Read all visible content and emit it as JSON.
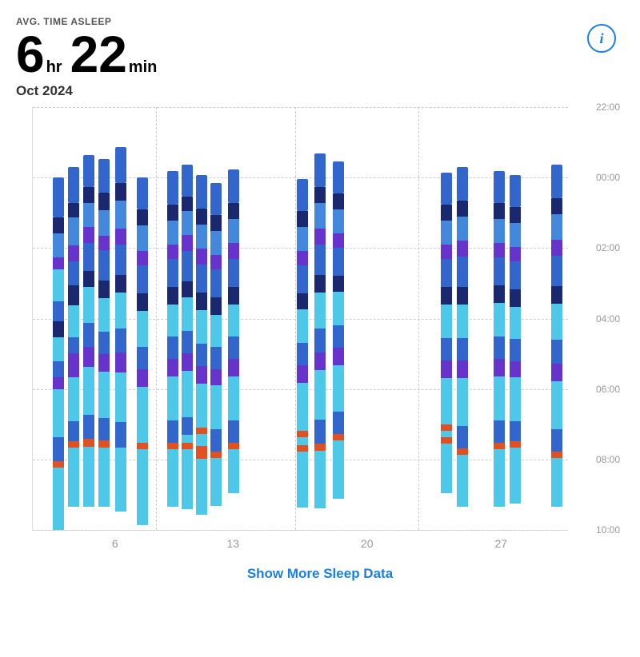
{
  "header": {
    "avg_label": "AVG. TIME ASLEEP",
    "hours": "6",
    "hr_label": "hr",
    "minutes": "22",
    "min_label": "min",
    "month": "Oct 2024",
    "info_icon": "i"
  },
  "chart": {
    "y_labels": [
      "22:00",
      "00:00",
      "02:00",
      "04:00",
      "06:00",
      "08:00",
      "10:00"
    ],
    "x_labels": [
      "6",
      "13",
      "20",
      "27"
    ]
  },
  "footer": {
    "show_more_label": "Show More Sleep Data"
  }
}
